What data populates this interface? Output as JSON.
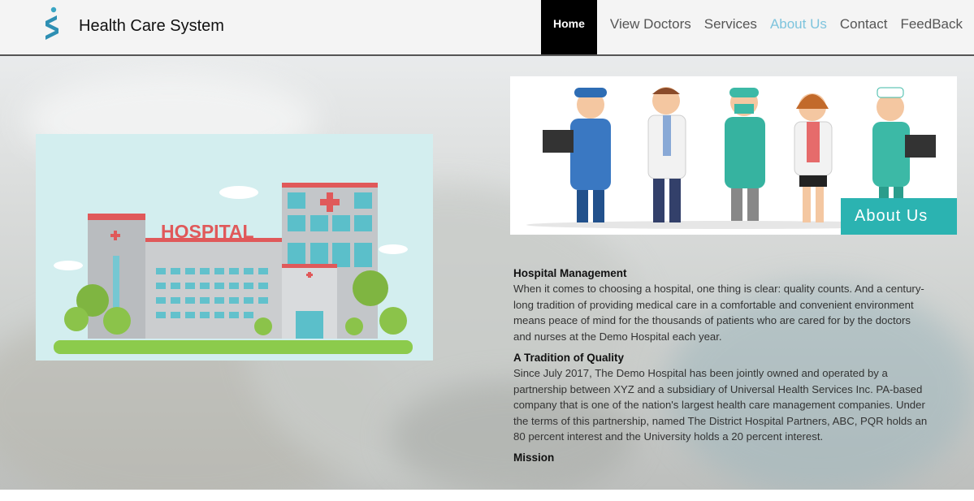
{
  "header": {
    "brand": "Health Care System",
    "nav": [
      {
        "label": "Home",
        "active": true
      },
      {
        "label": "View Doctors"
      },
      {
        "label": "Services"
      },
      {
        "label": "About Us",
        "highlighted": true
      },
      {
        "label": "Contact"
      },
      {
        "label": "FeedBack"
      }
    ]
  },
  "hospital_image": {
    "sign": "HOSPITAL"
  },
  "about_badge": "About Us",
  "sections": [
    {
      "title": "Hospital Management",
      "body": "When it comes to choosing a hospital, one thing is clear: quality counts. And a century-long tradition of providing medical care in a comfortable and convenient environment means peace of mind for the thousands of patients who are cared for by the doctors and nurses at the Demo Hospital each year."
    },
    {
      "title": "A Tradition of Quality",
      "body": "Since July 2017, The Demo Hospital has been jointly owned and operated by a partnership between XYZ and a subsidiary of Universal Health Services Inc. PA-based company that is one of the nation's largest health care management companies. Under the terms of this partnership, named The District Hospital Partners, ABC, PQR holds an 80 percent interest and the University holds a 20 percent interest."
    },
    {
      "title": "Mission",
      "body": ""
    }
  ],
  "colors": {
    "accent": "#2bb3b1",
    "nav_active_bg": "#000000",
    "nav_highlight": "#7ec4dd"
  }
}
